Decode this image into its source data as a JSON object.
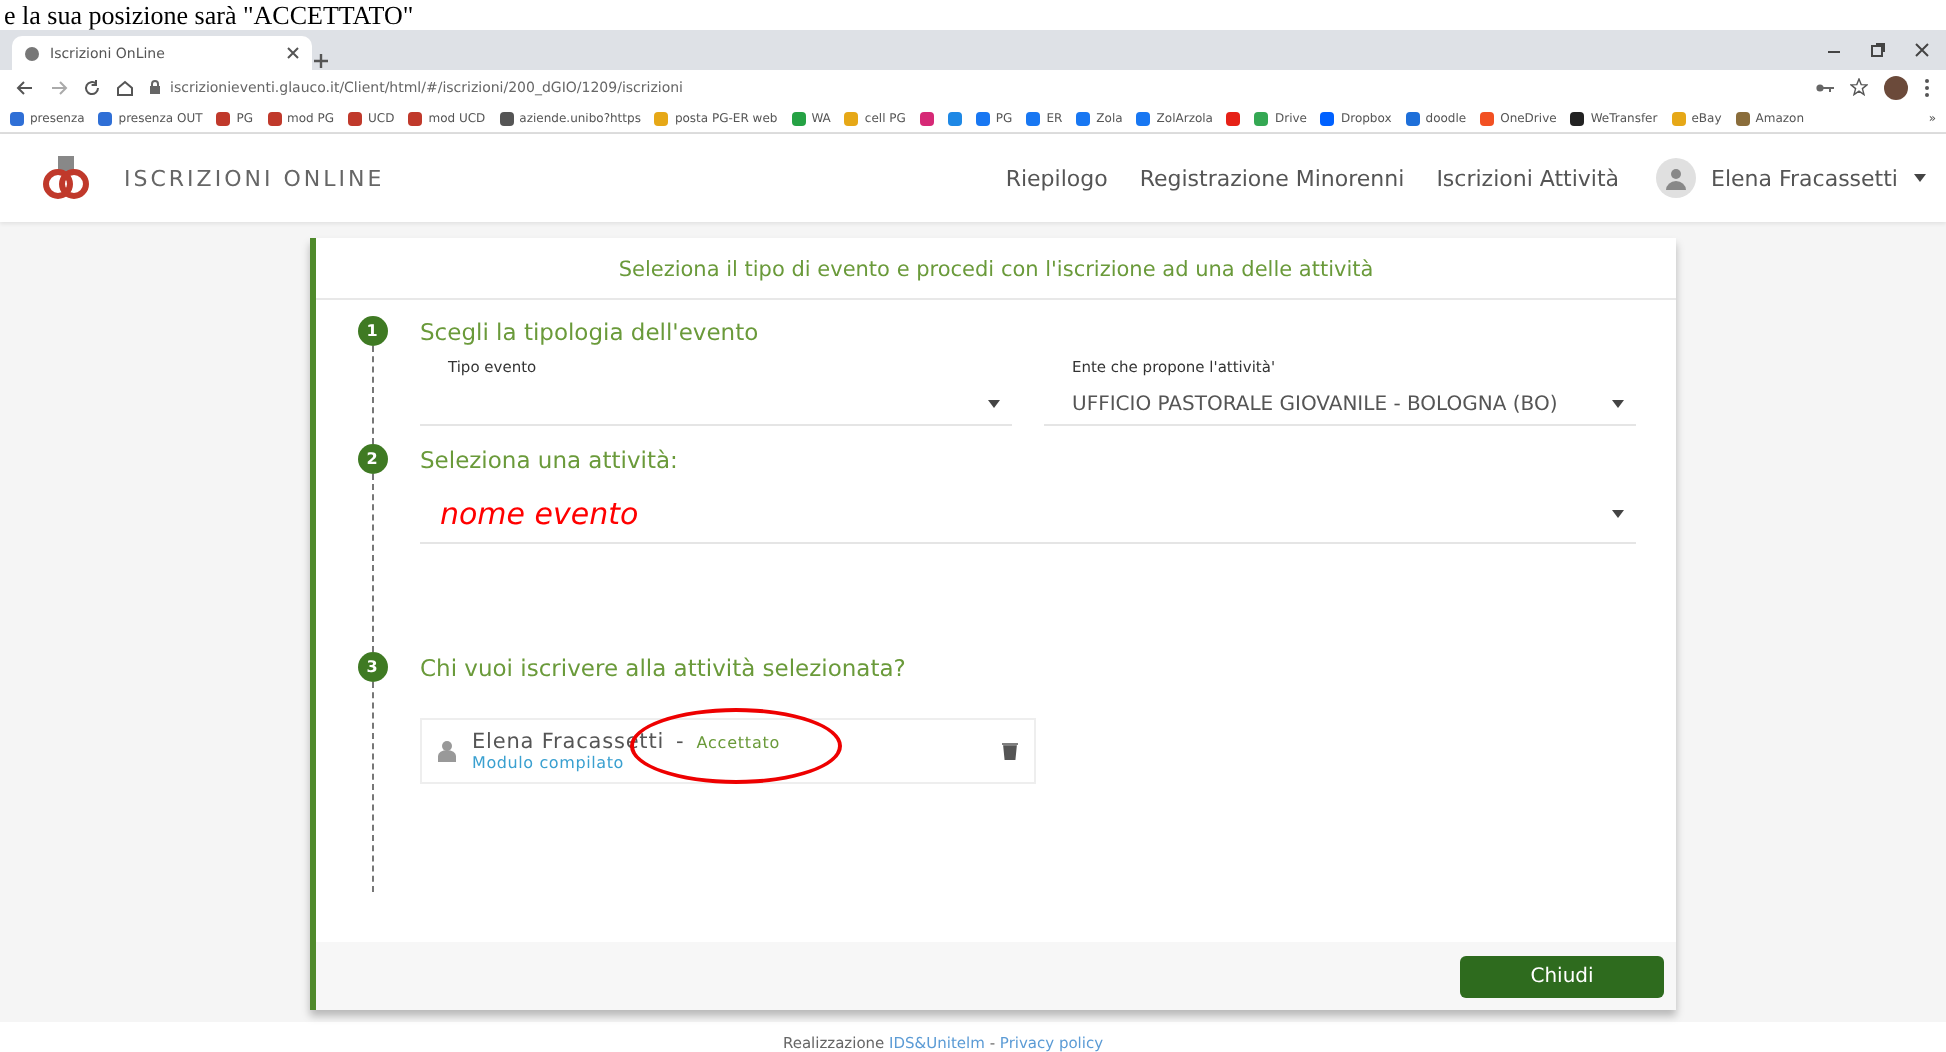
{
  "doc_caption": "e la sua posizione sarà \"ACCETTATO\"",
  "browser": {
    "tab_title": "Iscrizioni OnLine",
    "url": "iscrizionieventi.glauco.it/Client/html/#/iscrizioni/200_dGIO/1209/iscrizioni",
    "bookmarks": [
      {
        "label": "presenza",
        "color": "#2f6fd6"
      },
      {
        "label": "presenza OUT",
        "color": "#2f6fd6"
      },
      {
        "label": "PG",
        "color": "#c0392b"
      },
      {
        "label": "mod PG",
        "color": "#c0392b"
      },
      {
        "label": "UCD",
        "color": "#c0392b"
      },
      {
        "label": "mod UCD",
        "color": "#c0392b"
      },
      {
        "label": "aziende.unibo?https",
        "color": "#555555"
      },
      {
        "label": "posta PG-ER web",
        "color": "#e6a817"
      },
      {
        "label": "WA",
        "color": "#25a244"
      },
      {
        "label": "cell PG",
        "color": "#e6a817"
      },
      {
        "color": "#d62976"
      },
      {
        "color": "#1e88e5"
      },
      {
        "label": "PG",
        "color": "#1877f2"
      },
      {
        "label": "ER",
        "color": "#1877f2"
      },
      {
        "label": "Zola",
        "color": "#1877f2"
      },
      {
        "label": "ZolArzola",
        "color": "#1877f2"
      },
      {
        "color": "#e62117"
      },
      {
        "label": "Drive",
        "color": "#34a853"
      },
      {
        "label": "Dropbox",
        "color": "#0061ff"
      },
      {
        "label": "doodle",
        "color": "#1e6fd9"
      },
      {
        "label": "OneDrive",
        "color": "#f25022"
      },
      {
        "label": "WeTransfer",
        "color": "#222222"
      },
      {
        "label": "eBay",
        "color": "#e6a817"
      },
      {
        "label": "Amazon",
        "color": "#8a6d3b"
      }
    ],
    "more": "»"
  },
  "site": {
    "logo_text": "ISCRIZIONI ONLINE",
    "nav": [
      "Riepilogo",
      "Registrazione Minorenni",
      "Iscrizioni Attività"
    ],
    "user": "Elena Fracassetti"
  },
  "card": {
    "title": "Seleziona il tipo di evento e procedi con l'iscrizione ad una delle attività",
    "steps": [
      {
        "number": "1",
        "title": "Scegli la tipologia dell'evento",
        "fields": [
          {
            "kind": "select",
            "label": "Tipo evento"
          },
          {
            "kind": "select",
            "label": "Ente che propone l'attività'",
            "value": "UFFICIO PASTORALE GIOVANILE - BOLOGNA (BO)"
          }
        ]
      },
      {
        "number": "2",
        "title": "Seleziona una attività:",
        "fields": [
          {
            "kind": "annotated-select",
            "value": "nome evento"
          }
        ]
      },
      {
        "number": "3",
        "title": "Chi vuoi iscrivere alla attività selezionata?",
        "participants": [
          {
            "name": "Elena Fracassetti",
            "separator": "-",
            "status": "Accettato",
            "note": "Modulo compilato",
            "circled": true
          }
        ]
      }
    ],
    "button": "Chiudi"
  },
  "footer": {
    "prefix": "Realizzazione",
    "links": [
      "IDS&Unitelm",
      "Privacy policy"
    ],
    "separator": "-"
  }
}
